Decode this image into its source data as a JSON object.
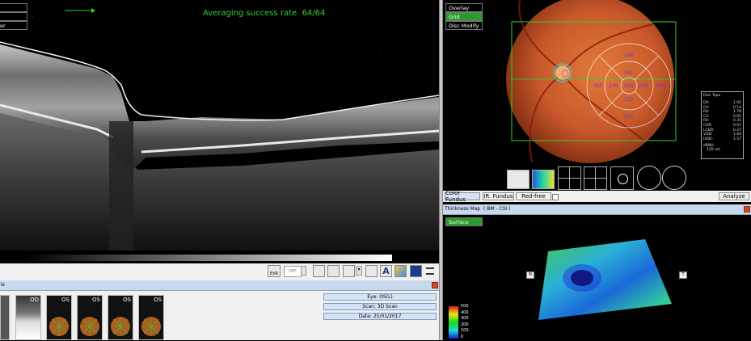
{
  "oct": {
    "averaging_text": "Averaging success rate  64/64",
    "left_menu_partial": "er",
    "slider_off": "OFF",
    "evr_label": "EVR"
  },
  "bottom_left": {
    "title_partial": "ls",
    "thumbs": [
      "",
      "OD",
      "OS",
      "OS",
      "OS",
      "OS"
    ]
  },
  "info": {
    "eye": "Eye: OS(L)",
    "scan": "Scan: 3D Scan",
    "date": "Date: 25/01/2017"
  },
  "fundus": {
    "menu": [
      "Overlay",
      "Grid",
      "Disc Modify"
    ],
    "grid_values": {
      "top_outer": "298",
      "top_inner": "291",
      "left_outer": "265",
      "left_inner": "249",
      "center": "288",
      "right_inner": "296",
      "right_outer": "263",
      "bottom_inner": "252",
      "bottom_outer": "247"
    },
    "disc_topo": {
      "title": "Disc Topo",
      "rows": [
        {
          "k": "DA:",
          "v": "1.92"
        },
        {
          "k": "CA:",
          "v": "0.14"
        },
        {
          "k": "RA:",
          "v": "1.78"
        },
        {
          "k": "CV:",
          "v": "0.05"
        },
        {
          "k": "RV:",
          "v": "0.33"
        },
        {
          "k": "CDR:",
          "v": "0.07"
        },
        {
          "k": "LCDR:",
          "v": "0.27"
        },
        {
          "k": "VDD:",
          "v": "1.64"
        },
        {
          "k": "HDD:",
          "v": "1.57"
        }
      ],
      "note1": "dRNH",
      "note2": "120 um"
    },
    "buttons": [
      "Color Fundus",
      "IR. Fundus",
      "Red-free"
    ],
    "analyze": "Analyze"
  },
  "thickness": {
    "title": "Thickness Map  ( BM - CSI )",
    "surface": "Surface",
    "n_label": "N",
    "t_label": "T",
    "scale": [
      "500",
      "400",
      "300",
      "200",
      "100",
      "0"
    ],
    "colors": {
      "accent": "#2fd22f",
      "panel_header": "#c8d8ee"
    }
  }
}
